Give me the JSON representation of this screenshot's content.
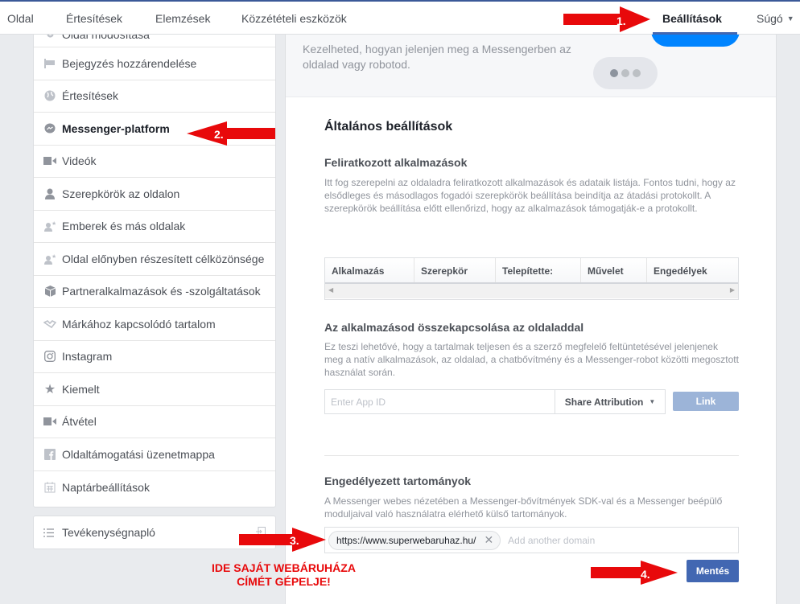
{
  "topnav": {
    "items": [
      {
        "label": "Oldal"
      },
      {
        "label": "Értesítések"
      },
      {
        "label": "Elemzések"
      },
      {
        "label": "Közzétételi eszközök"
      },
      {
        "label": "Beállítások",
        "active": true
      },
      {
        "label": "Súgó",
        "dropdown": true
      }
    ]
  },
  "sidebar": {
    "items": [
      {
        "label": "Oldal módosítása",
        "icon": "gear-icon"
      },
      {
        "label": "Bejegyzés hozzárendelése",
        "icon": "flag-icon"
      },
      {
        "label": "Értesítések",
        "icon": "globe-icon"
      },
      {
        "label": "Messenger-platform",
        "icon": "messenger-icon",
        "active": true
      },
      {
        "label": "Videók",
        "icon": "video-camera-icon"
      },
      {
        "label": "Szerepkörök az oldalon",
        "icon": "person-icon"
      },
      {
        "label": "Emberek és más oldalak",
        "icon": "person-star-icon"
      },
      {
        "label": "Oldal előnyben részesített célközönsége",
        "icon": "person-star-icon"
      },
      {
        "label": "Partneralkalmazások és -szolgáltatások",
        "icon": "cube-icon"
      },
      {
        "label": "Márkához kapcsolódó tartalom",
        "icon": "handshake-icon"
      },
      {
        "label": "Instagram",
        "icon": "instagram-icon"
      },
      {
        "label": "Kiemelt",
        "icon": "star-icon"
      },
      {
        "label": "Átvétel",
        "icon": "video-camera-icon"
      },
      {
        "label": "Oldaltámogatási üzenetmappa",
        "icon": "facebook-icon"
      },
      {
        "label": "Naptárbeállítások",
        "icon": "calendar-icon"
      }
    ],
    "activity_log": {
      "label": "Tevékenységnapló",
      "icon": "list-icon",
      "action_icon": "export-icon"
    }
  },
  "main": {
    "hero_text": "Kezelheted, hogyan jelenjen meg a Messengerben az oldalad vagy robotod.",
    "title": "Általános beállítások",
    "subscribed_apps": {
      "heading": "Feliratkozott alkalmazások",
      "description": "Itt fog szerepelni az oldaladra feliratkozott alkalmazások és adataik listája. Fontos tudni, hogy az elsődleges és másodlagos fogadói szerepkörök beállítása beindítja az átadási protokollt. A szerepkörök beállítása előtt ellenőrizd, hogy az alkalmazások támogatják-e a protokollt.",
      "columns": [
        "Alkalmazás",
        "Szerepkör",
        "Telepítette:",
        "Művelet",
        "Engedélyek"
      ],
      "rows": []
    },
    "link_app": {
      "heading": "Az alkalmazásod összekapcsolása az oldaladdal",
      "description": "Ez teszi lehetővé, hogy a tartalmak teljesen és a szerző megfelelő feltüntetésével jelenjenek meg a natív alkalmazások, az oldalad, a chatbővítmény és a Messenger-robot közötti megosztott használat során.",
      "app_id_placeholder": "Enter App ID",
      "app_id_value": "",
      "share_attribution_label": "Share Attribution",
      "link_label": "Link"
    },
    "whitelisted_domains": {
      "heading": "Engedélyezett tartományok",
      "description": "A Messenger webes nézetében a Messenger-bővítmények SDK-val és a Messenger beépülő moduljaival való használatra elérhető külső tartományok.",
      "domains": [
        "https://www.superwebaruhaz.hu/"
      ],
      "add_placeholder": "Add another domain",
      "save_label": "Mentés"
    }
  },
  "annotations": {
    "steps": [
      "1.",
      "2.",
      "3.",
      "4."
    ],
    "note": "IDE SAJÁT WEBÁRUHÁZA CÍMÉT GÉPELJE!",
    "color": "#e8090b"
  }
}
